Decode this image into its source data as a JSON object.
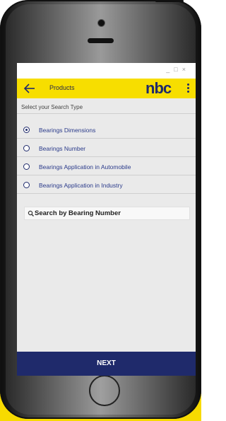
{
  "window": {
    "controls": [
      "_",
      "□",
      "×"
    ]
  },
  "toolbar": {
    "title": "Products",
    "logo": "nbc",
    "back_icon": "back-arrow-icon",
    "menu_icon": "more-vert-icon",
    "bg_color": "#f7de00",
    "brand_color": "#1f2a6b"
  },
  "search_type": {
    "label": "Select your Search Type",
    "options": [
      {
        "label": "Bearings Dimensions",
        "checked": true
      },
      {
        "label": "Bearings Number",
        "checked": false
      },
      {
        "label": "Bearings Application in Automobile",
        "checked": false
      },
      {
        "label": "Bearings Application in Industry",
        "checked": false
      }
    ]
  },
  "search": {
    "icon": "search-icon",
    "text": "Search by Bearing Number"
  },
  "footer": {
    "next_label": "NEXT"
  }
}
